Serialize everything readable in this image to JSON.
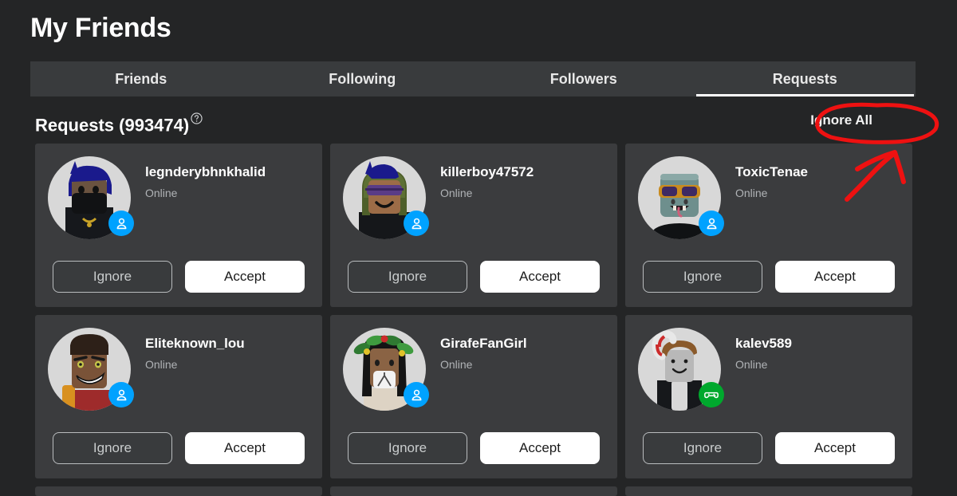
{
  "header": {
    "title": "My Friends"
  },
  "tabs": [
    {
      "label": "Friends",
      "active": false
    },
    {
      "label": "Following",
      "active": false
    },
    {
      "label": "Followers",
      "active": false
    },
    {
      "label": "Requests",
      "active": true
    }
  ],
  "section": {
    "title": "Requests (993474)",
    "count": 993474,
    "help_icon": "question-circle-icon",
    "ignore_all_label": "Ignore All"
  },
  "buttons": {
    "ignore_label": "Ignore",
    "accept_label": "Accept"
  },
  "cards": [
    {
      "username": "legnderybhnkhalid",
      "status": "Online",
      "badge": "online",
      "badge_icon": "person-icon"
    },
    {
      "username": "killerboy47572",
      "status": "Online",
      "badge": "online",
      "badge_icon": "person-icon"
    },
    {
      "username": "ToxicTenae",
      "status": "Online",
      "badge": "online",
      "badge_icon": "person-icon"
    },
    {
      "username": "Eliteknown_lou",
      "status": "Online",
      "badge": "online",
      "badge_icon": "person-icon"
    },
    {
      "username": "GirafeFanGirl",
      "status": "Online",
      "badge": "online",
      "badge_icon": "person-icon"
    },
    {
      "username": "kalev589",
      "status": "Online",
      "badge": "ingame",
      "badge_icon": "gamepad-icon"
    }
  ],
  "annotations": {
    "highlight_color": "#ee1111",
    "ellipse_target": "Ignore All",
    "arrow_target": "Ignore All"
  },
  "colors": {
    "page_background": "#242526",
    "card_background": "#3b3c3e",
    "tabbar_background": "#393b3d",
    "accent_online": "#00a2ff",
    "accent_ingame": "#00a82d",
    "annotation_red": "#ee1111"
  }
}
